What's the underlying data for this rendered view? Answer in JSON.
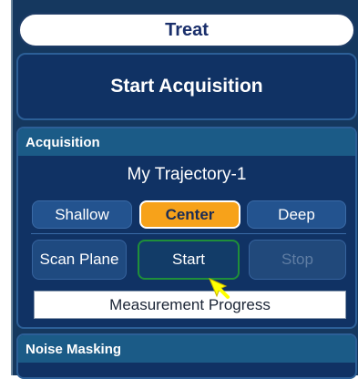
{
  "tab": {
    "label": "Treat"
  },
  "start_acquisition": {
    "label": "Start Acquisition"
  },
  "acquisition": {
    "title": "Acquisition",
    "trajectory_name": "My Trajectory-1",
    "depth_buttons": [
      {
        "label": "Shallow",
        "selected": false
      },
      {
        "label": "Center",
        "selected": true
      },
      {
        "label": "Deep",
        "selected": false
      }
    ],
    "action_buttons": [
      {
        "label": "Scan Plane",
        "enabled": true
      },
      {
        "label": "Start",
        "enabled": true
      },
      {
        "label": "Stop",
        "enabled": false
      }
    ],
    "progress_label": "Measurement Progress"
  },
  "noise_masking": {
    "title": "Noise Masking"
  },
  "colors": {
    "panel_bg": "#15385f",
    "accent_selected": "#f7a21a",
    "start_border": "#1f8f3a",
    "cursor": "#ffff00"
  },
  "icons": {
    "cursor": "mouse-pointer-arrow-icon"
  }
}
